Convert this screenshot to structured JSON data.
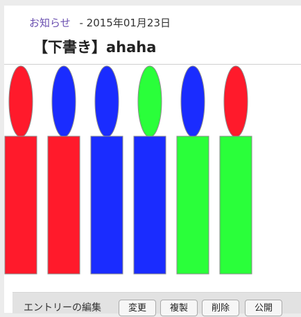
{
  "header": {
    "category": "お知らせ",
    "date_separator": " - ",
    "date": "2015年01月23日",
    "title": "【下書き】ahaha"
  },
  "candles": [
    {
      "flame_color": "#ff1a2b",
      "body_color": "#ff1a2b"
    },
    {
      "flame_color": "#1a2cff",
      "body_color": "#ff1a2b"
    },
    {
      "flame_color": "#1a2cff",
      "body_color": "#1a2cff"
    },
    {
      "flame_color": "#2aff3a",
      "body_color": "#1a2cff"
    },
    {
      "flame_color": "#1a2cff",
      "body_color": "#2aff3a"
    },
    {
      "flame_color": "#ff1a2b",
      "body_color": "#2aff3a"
    }
  ],
  "footer": {
    "label": "エントリーの編集",
    "buttons": [
      "変更",
      "複製",
      "削除",
      "公開"
    ]
  }
}
